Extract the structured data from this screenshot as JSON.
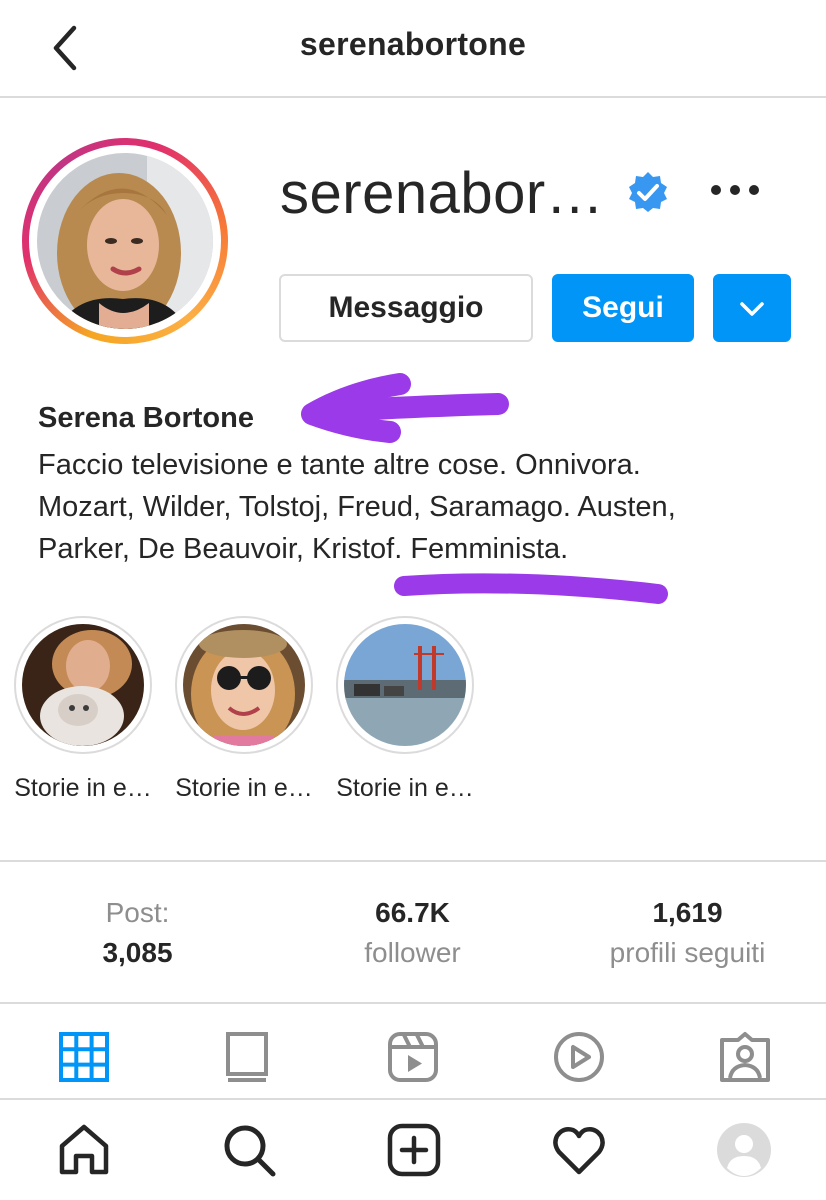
{
  "header": {
    "title": "serenabortone"
  },
  "profile": {
    "username": "serenabor…",
    "message_label": "Messaggio",
    "follow_label": "Segui",
    "full_name": "Serena Bortone",
    "bio_lines": [
      "Faccio televisione e tante altre cose. Onnivora.",
      "Mozart, Wilder, Tolstoj, Freud, Saramago. Austen,",
      "Parker, De Beauvoir, Kristof. Femminista."
    ]
  },
  "highlights": [
    {
      "label": "Storie in e…"
    },
    {
      "label": "Storie in e…"
    },
    {
      "label": "Storie in e…"
    }
  ],
  "stats": {
    "posts": {
      "label": "Post:",
      "value": "3,085"
    },
    "followers": {
      "value": "66.7K",
      "label": "follower"
    },
    "following": {
      "value": "1,619",
      "label": "profili seguiti"
    }
  },
  "icons": {
    "tabs": [
      "grid-icon",
      "feed-icon",
      "reels-icon",
      "igtv-icon",
      "tagged-icon"
    ],
    "nav": [
      "home-icon",
      "search-icon",
      "new-post-icon",
      "activity-heart-icon",
      "profile-avatar-icon"
    ]
  },
  "colors": {
    "accent": "#0095f6",
    "verified": "#3897f0",
    "annotation": "#9b3ae8",
    "text": "#262626",
    "muted": "#8e8e8e",
    "divider": "#dbdbdb"
  }
}
